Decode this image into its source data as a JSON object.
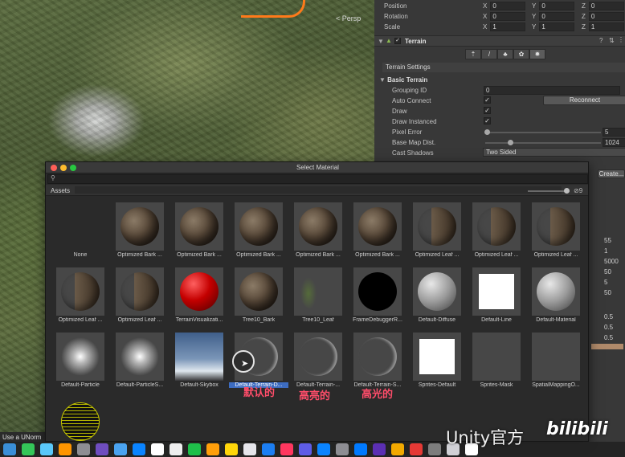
{
  "scene": {
    "persp_label": "< Persp",
    "bottom_label": "Use a UNorm"
  },
  "inspector": {
    "transform": [
      {
        "label": "Position",
        "x": "0",
        "y": "0",
        "z": "0"
      },
      {
        "label": "Rotation",
        "x": "0",
        "y": "0",
        "z": "0"
      },
      {
        "label": "Scale",
        "x": "1",
        "y": "1",
        "z": "1"
      }
    ],
    "component_title": "Terrain",
    "terrain_settings_label": "Terrain Settings",
    "basic_terrain_label": "Basic Terrain",
    "grouping_id_label": "Grouping ID",
    "grouping_id_value": "0",
    "auto_connect_label": "Auto Connect",
    "reconnect_label": "Reconnect",
    "draw_label": "Draw",
    "draw_instanced_label": "Draw Instanced",
    "pixel_error_label": "Pixel Error",
    "pixel_error_value": "5",
    "base_map_label": "Base Map Dist.",
    "base_map_value": "1024",
    "cast_shadows_label": "Cast Shadows",
    "cast_shadows_value": "Two Sided",
    "create_label": "Create...",
    "right_numbers": [
      "55",
      "1",
      "5000",
      "50",
      "5",
      "50",
      "0.5",
      "0.5",
      "0.5"
    ]
  },
  "dialog": {
    "title": "Select Material",
    "assets_label": "Assets",
    "hidden_count": "9",
    "items": [
      {
        "name": "None",
        "kind": "none"
      },
      {
        "name": "Optimized Bark ...",
        "kind": "bark"
      },
      {
        "name": "Optimized Bark ...",
        "kind": "bark"
      },
      {
        "name": "Optimized Bark ...",
        "kind": "bark"
      },
      {
        "name": "Optimized Bark ...",
        "kind": "bark"
      },
      {
        "name": "Optimized Bark ...",
        "kind": "bark"
      },
      {
        "name": "Optimized Leaf ...",
        "kind": "leaf"
      },
      {
        "name": "Optimized Leaf ...",
        "kind": "leaf"
      },
      {
        "name": "Optimized Leaf ...",
        "kind": "leaf"
      },
      {
        "name": "Optimized Leaf ...",
        "kind": "leaf"
      },
      {
        "name": "Optimized Leaf ...",
        "kind": "leaf"
      },
      {
        "name": "TerrainVisualizati...",
        "kind": "red"
      },
      {
        "name": "Tree10_Bark",
        "kind": "bark"
      },
      {
        "name": "Tree10_Leaf",
        "kind": "leafonly"
      },
      {
        "name": "FrameDebuggerR...",
        "kind": "black"
      },
      {
        "name": "Default-Diffuse",
        "kind": "grey"
      },
      {
        "name": "Default-Line",
        "kind": "whitesq"
      },
      {
        "name": "Default-Material",
        "kind": "grey"
      },
      {
        "name": "Default-Particle",
        "kind": "particle"
      },
      {
        "name": "Default-ParticleS...",
        "kind": "particle"
      },
      {
        "name": "Default-Skybox",
        "kind": "skybox"
      },
      {
        "name": "Default-Terrain-D...",
        "kind": "crescent",
        "selected": true
      },
      {
        "name": "Default-Terrain-...",
        "kind": "crescent"
      },
      {
        "name": "Default-Terrain-S...",
        "kind": "crescent"
      },
      {
        "name": "Sprites-Default",
        "kind": "whitesq"
      },
      {
        "name": "Sprites-Mask",
        "kind": "blank"
      },
      {
        "name": "SpatialMappingO...",
        "kind": "blank"
      },
      {
        "name": "",
        "kind": "wire"
      }
    ],
    "annotations": [
      "默认的",
      "高亮的",
      "高光的"
    ]
  },
  "watermark": {
    "text": "Unity官方",
    "brand": "bilibili"
  }
}
